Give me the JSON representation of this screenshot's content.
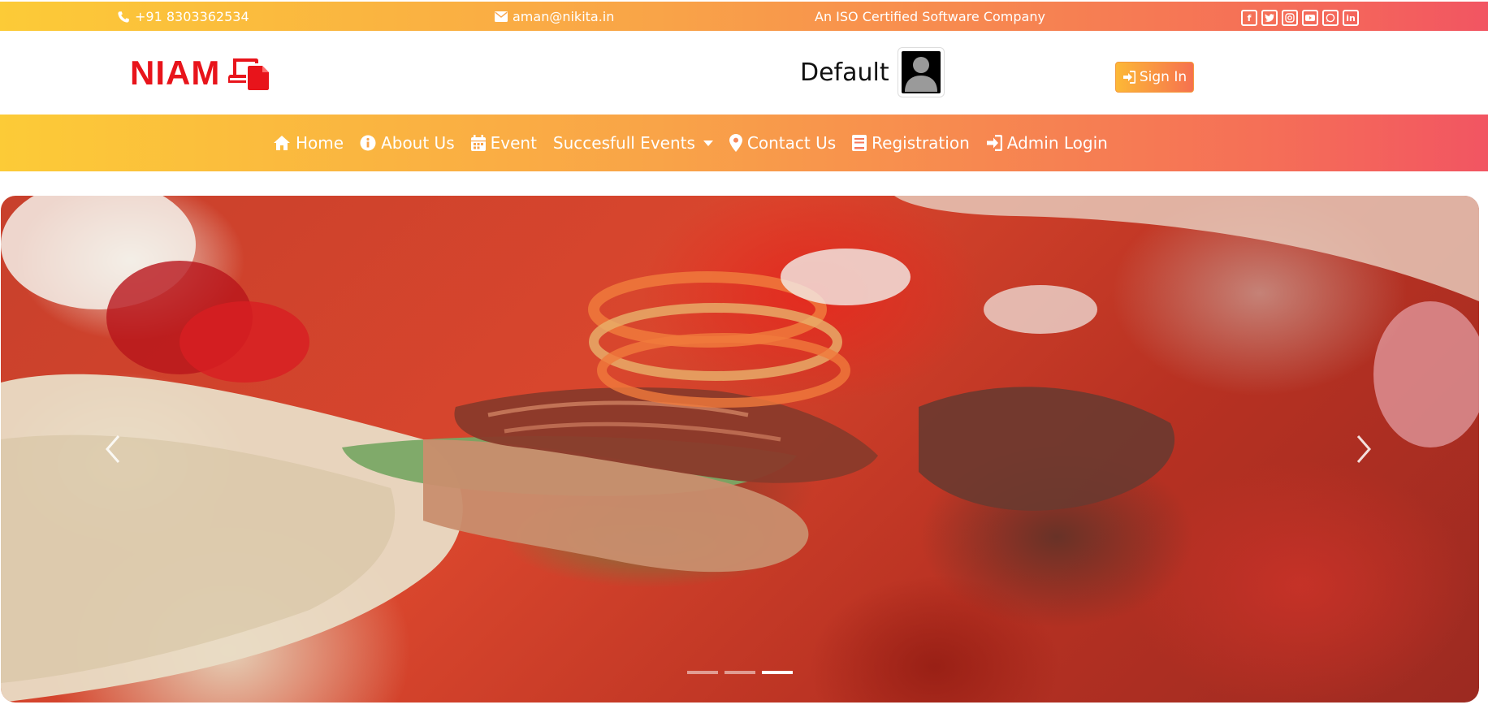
{
  "topbar": {
    "phone": "+91 8303362534",
    "email": "aman@nikita.in",
    "tagline": "An ISO Certified Software Company",
    "socials": [
      "facebook-icon",
      "twitter-icon",
      "instagram-icon",
      "youtube-icon",
      "whatsapp-icon",
      "linkedin-icon"
    ]
  },
  "header": {
    "logo_text": "NIAM",
    "user_name": "Default",
    "signin_label": "Sign In"
  },
  "nav": {
    "items": [
      {
        "label": "Home",
        "icon": "home-icon"
      },
      {
        "label": "About Us",
        "icon": "info-icon"
      },
      {
        "label": "Event",
        "icon": "calendar-icon"
      },
      {
        "label": "Succesfull Events",
        "icon": "dropdown-caret-icon"
      },
      {
        "label": "Contact Us",
        "icon": "map-marker-icon"
      },
      {
        "label": "Registration",
        "icon": "id-card-icon"
      },
      {
        "label": "Admin Login",
        "icon": "sign-in-icon"
      }
    ]
  },
  "carousel": {
    "slide_count": 3,
    "active_slide": 3
  },
  "colors": {
    "gradient_start": "#fccb37",
    "gradient_end": "#f25562",
    "brand_red": "#e8141b"
  }
}
